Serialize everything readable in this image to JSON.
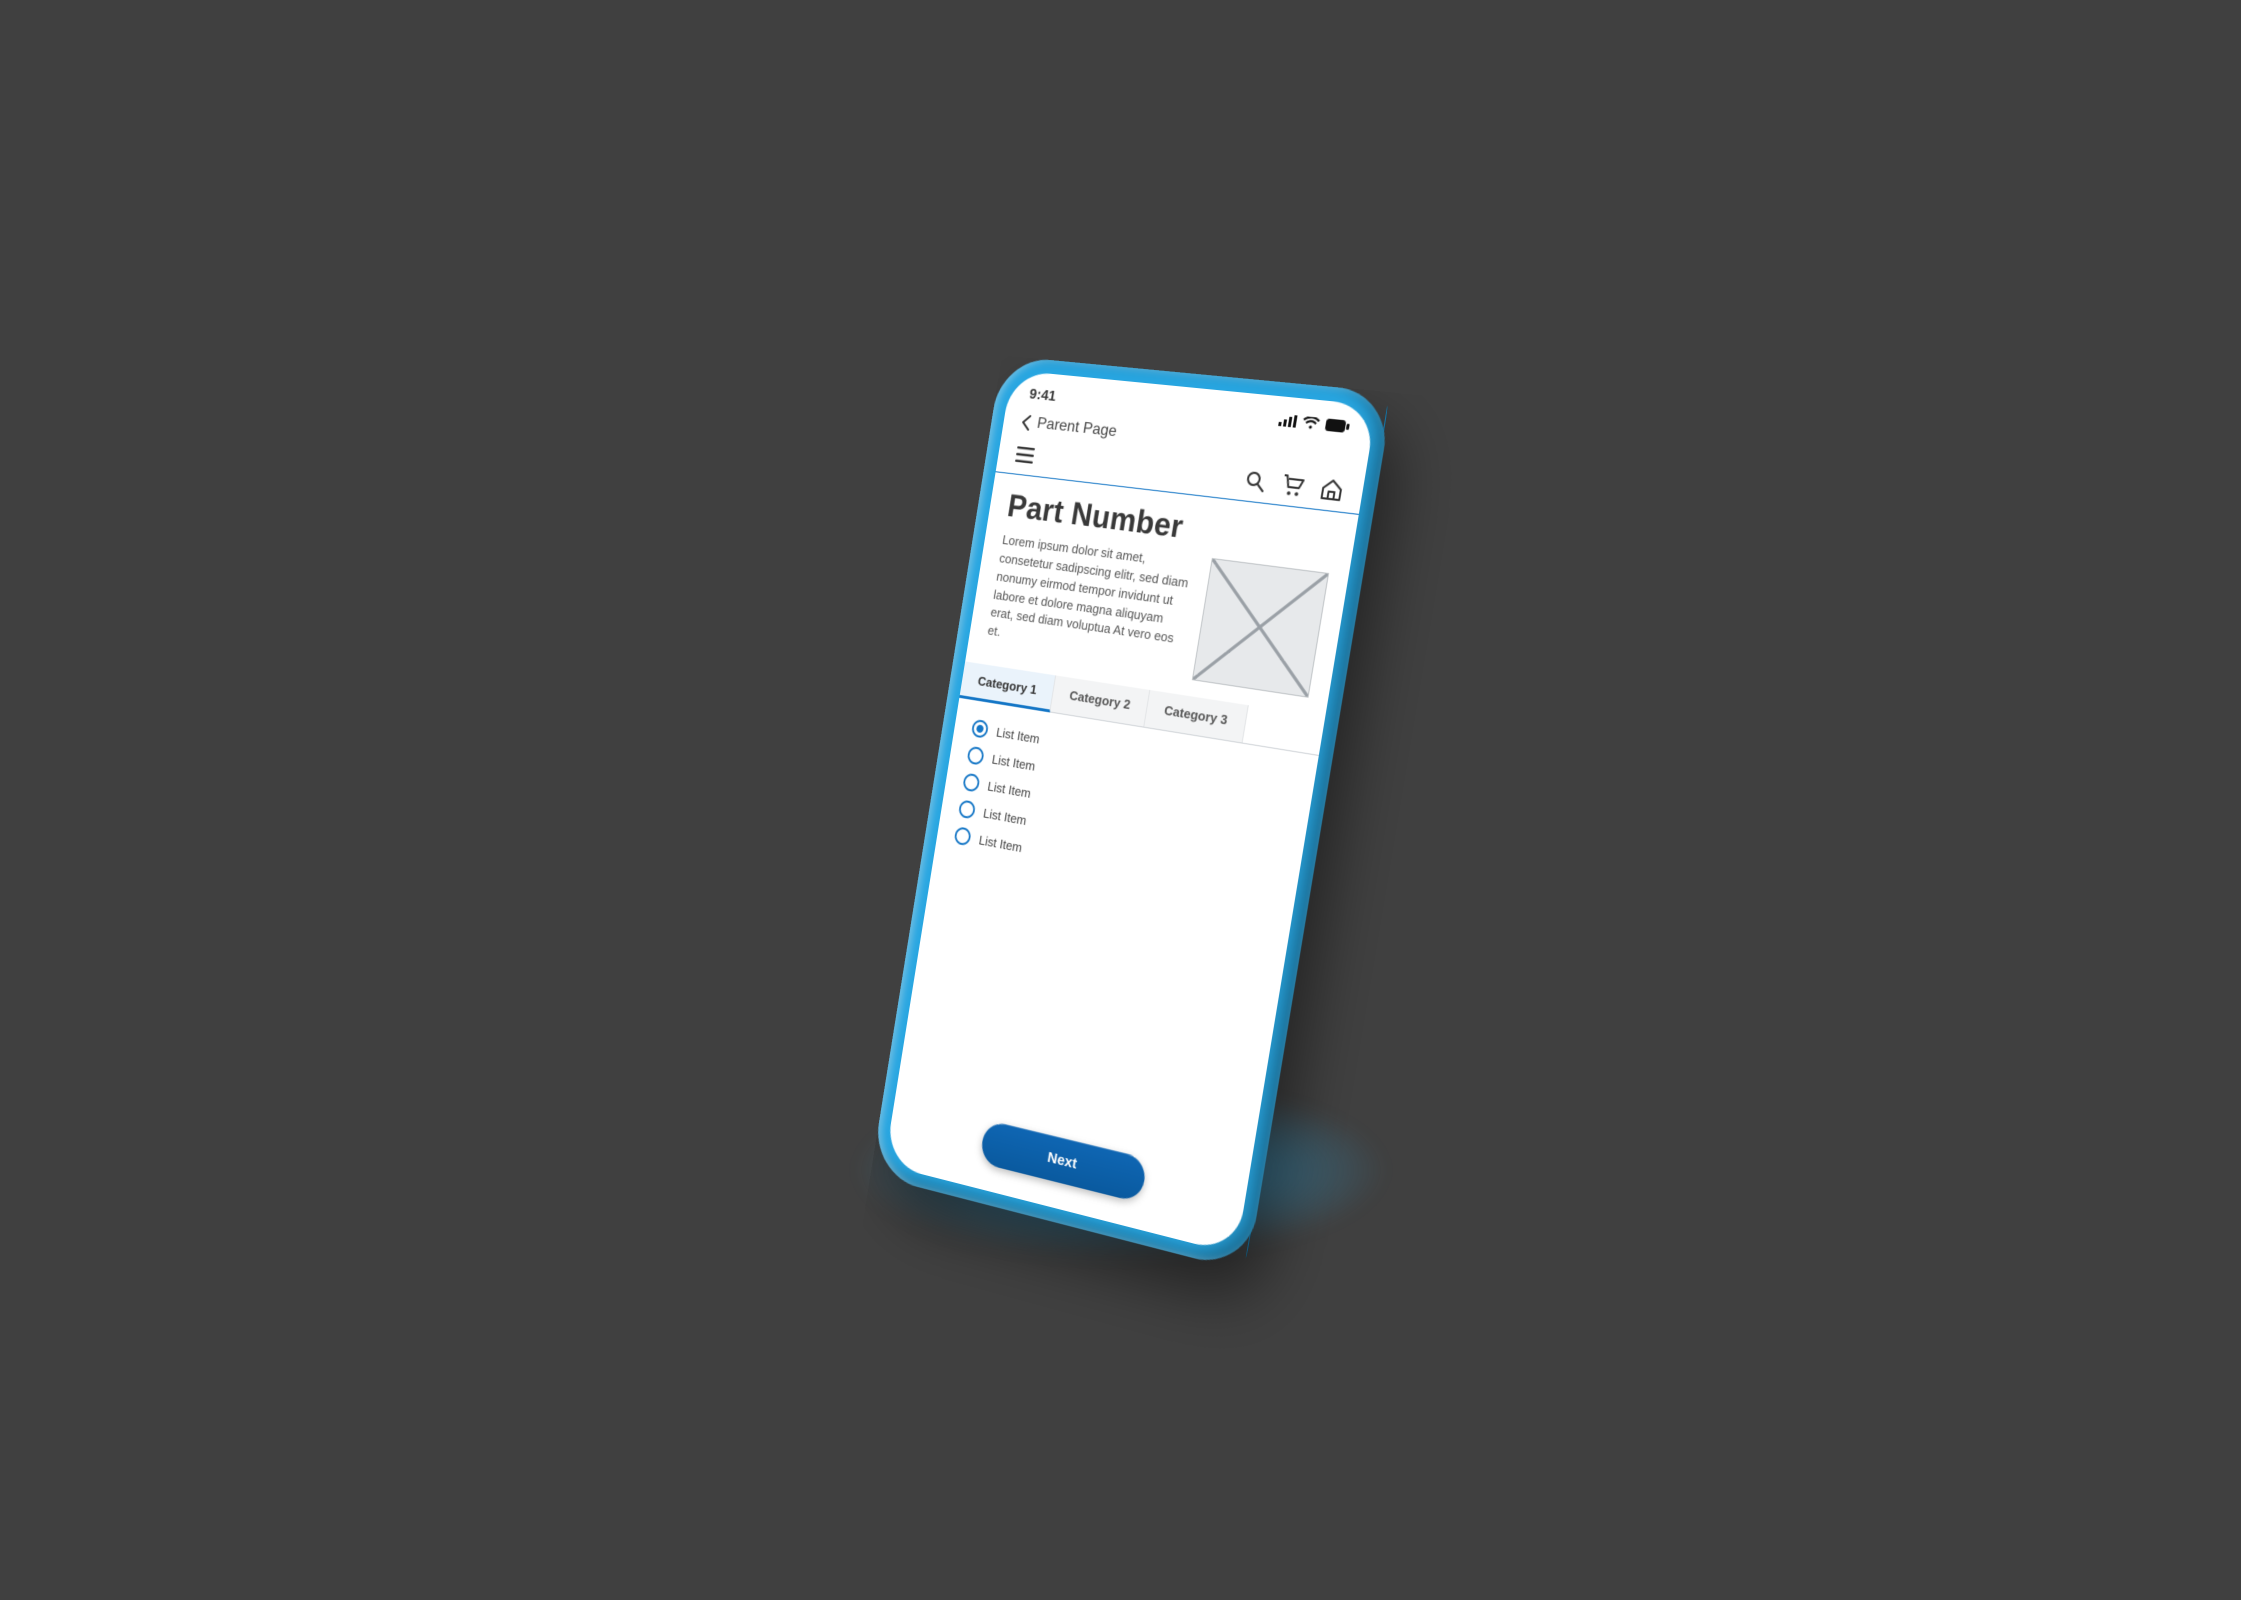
{
  "status": {
    "time": "9:41"
  },
  "back": {
    "label": "Parent Page"
  },
  "page": {
    "title": "Part Number",
    "description": "Lorem ipsum dolor sit amet, consetetur sadipscing elitr, sed diam nonumy eirmod tempor invidunt ut labore et dolore magna aliquyam erat, sed diam voluptua At vero eos et."
  },
  "tabs": [
    {
      "label": "Category 1",
      "active": true
    },
    {
      "label": "Category 2",
      "active": false
    },
    {
      "label": "Category 3",
      "active": false
    }
  ],
  "list": [
    {
      "label": "List Item",
      "selected": true
    },
    {
      "label": "List Item",
      "selected": false
    },
    {
      "label": "List Item",
      "selected": false
    },
    {
      "label": "List Item",
      "selected": false
    },
    {
      "label": "List Item",
      "selected": false
    }
  ],
  "footer": {
    "next": "Next"
  }
}
